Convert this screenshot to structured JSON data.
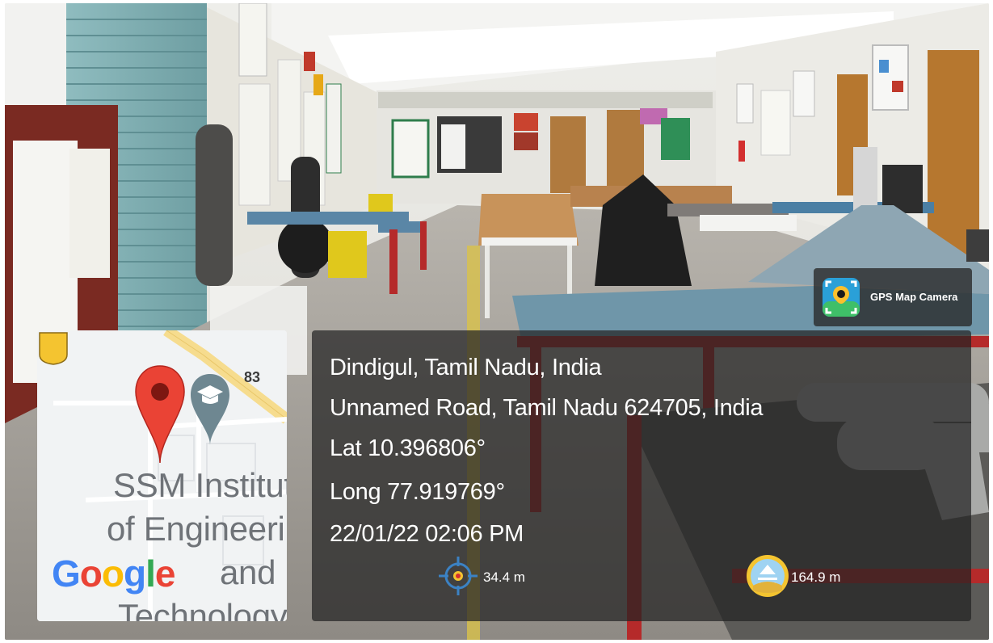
{
  "app": {
    "name": "GPS Map Camera"
  },
  "map": {
    "place_name_lines": [
      "SSM Institute",
      "of Engineering",
      "and",
      "Technology"
    ],
    "road_number": "83",
    "provider": "Google",
    "provider_letters": [
      {
        "ch": "G",
        "color": "#4285F4"
      },
      {
        "ch": "o",
        "color": "#EA4335"
      },
      {
        "ch": "o",
        "color": "#FBBC05"
      },
      {
        "ch": "g",
        "color": "#4285F4"
      },
      {
        "ch": "l",
        "color": "#34A853"
      },
      {
        "ch": "e",
        "color": "#EA4335"
      }
    ],
    "pin_color": "#EA4335",
    "poi_icon": "graduation-cap-icon",
    "road_color": "#F6DC8E"
  },
  "location": {
    "title": "Dindigul, Tamil Nadu, India",
    "address": "Unnamed Road, Tamil Nadu 624705, India",
    "latitude": "Lat 10.396806°",
    "longitude": "Long 77.919769°",
    "datetime": "22/01/22 02:06 PM"
  },
  "metrics": {
    "accuracy": "34.4 m",
    "accuracy_icon": "crosshair-icon",
    "altitude": "164.9 m",
    "altitude_icon": "altitude-icon"
  }
}
